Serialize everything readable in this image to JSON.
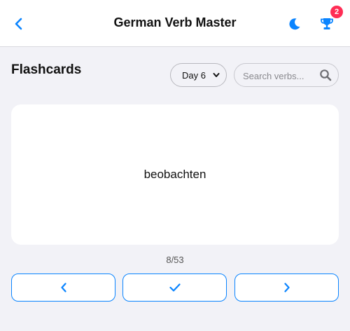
{
  "colors": {
    "accent": "#0a84ff",
    "badge": "#ff2d55",
    "background": "#f2f2f7"
  },
  "header": {
    "title": "German Verb Master",
    "back_icon": "chevron-left-icon",
    "theme_icon": "moon-icon",
    "achievements_icon": "trophy-icon",
    "achievements_badge": "2"
  },
  "toolbar": {
    "heading": "Flashcards",
    "day_select": {
      "selected": "Day 6"
    },
    "search": {
      "placeholder": "Search verbs...",
      "value": ""
    }
  },
  "flashcard": {
    "word": "beobachten"
  },
  "progress": {
    "label": "8/53",
    "current": 8,
    "total": 53
  },
  "controls": {
    "prev_icon": "chevron-left-icon",
    "check_icon": "check-icon",
    "next_icon": "chevron-right-icon"
  }
}
